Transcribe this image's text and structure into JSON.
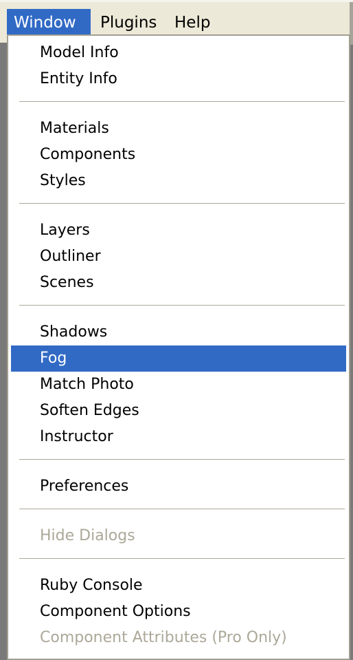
{
  "menubar": {
    "items": [
      {
        "label": "Window",
        "active": true
      },
      {
        "label": "Plugins",
        "active": false
      },
      {
        "label": "Help",
        "active": false
      }
    ]
  },
  "menu": {
    "title": "Window",
    "groups": [
      [
        {
          "label": "Model Info",
          "state": "normal"
        },
        {
          "label": "Entity Info",
          "state": "normal"
        }
      ],
      [
        {
          "label": "Materials",
          "state": "normal"
        },
        {
          "label": "Components",
          "state": "normal"
        },
        {
          "label": "Styles",
          "state": "normal"
        }
      ],
      [
        {
          "label": "Layers",
          "state": "normal"
        },
        {
          "label": "Outliner",
          "state": "normal"
        },
        {
          "label": "Scenes",
          "state": "normal"
        }
      ],
      [
        {
          "label": "Shadows",
          "state": "normal"
        },
        {
          "label": "Fog",
          "state": "highlighted"
        },
        {
          "label": "Match Photo",
          "state": "normal"
        },
        {
          "label": "Soften Edges",
          "state": "normal"
        },
        {
          "label": "Instructor",
          "state": "normal"
        }
      ],
      [
        {
          "label": "Preferences",
          "state": "normal"
        }
      ],
      [
        {
          "label": "Hide Dialogs",
          "state": "disabled"
        }
      ],
      [
        {
          "label": "Ruby Console",
          "state": "normal"
        },
        {
          "label": "Component Options",
          "state": "normal"
        },
        {
          "label": "Component Attributes (Pro Only)",
          "state": "disabled"
        }
      ]
    ]
  },
  "colors": {
    "highlight": "#316ac5",
    "disabled_text": "#aca899",
    "menubar_bg": "#ece9d8"
  }
}
